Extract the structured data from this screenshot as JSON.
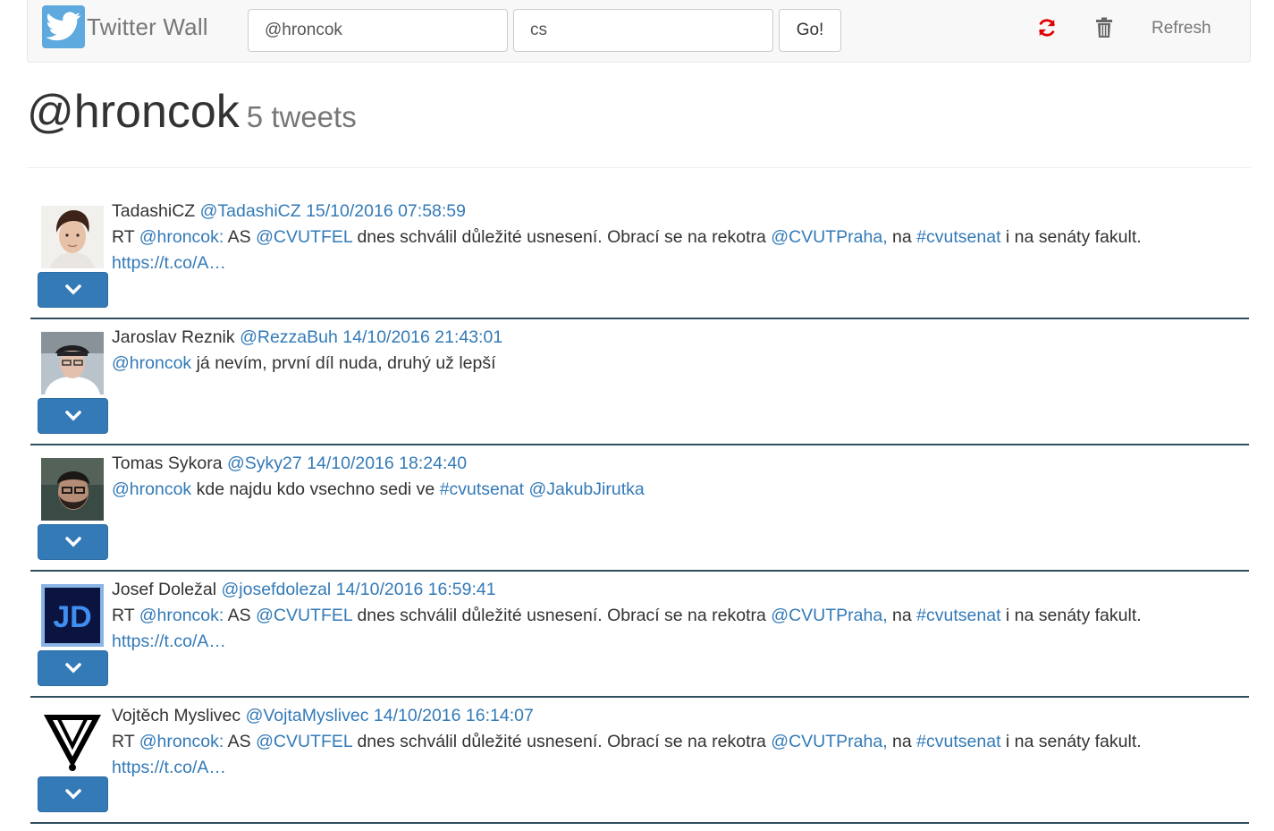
{
  "brand": {
    "title": "Twitter Wall",
    "logo_icon": "twitter-bird-icon"
  },
  "search": {
    "query_value": "@hroncok",
    "lang_value": "cs",
    "go_label": "Go!"
  },
  "toolbar": {
    "refresh_icon": "refresh-icon",
    "trash_icon": "trash-icon",
    "refresh_label": "Refresh"
  },
  "header": {
    "title": "@hroncok",
    "count": "5 tweets"
  },
  "colors": {
    "link": "#337ab7",
    "button": "#337ab7",
    "refresh_icon": "#e00000",
    "separator": "#2f4f5f"
  },
  "tweets": [
    {
      "author": "TadashiCZ",
      "handle": "@TadashiCZ",
      "time": "15/10/2016 07:58:59",
      "rt": "RT",
      "mention": "@hroncok:",
      "t1": "AS",
      "m2": "@CVUTFEL",
      "t2": "dnes schválil důležité usnesení. Obrací se na rekotra",
      "m3": "@CVUTPraha,",
      "t3": "na",
      "tag": "#cvutsenat",
      "t4": "i na senáty fakult.",
      "link": "https://t.co/A…"
    },
    {
      "author": "Jaroslav Reznik",
      "handle": "@RezzaBuh",
      "time": "14/10/2016 21:43:01",
      "mention": "@hroncok",
      "text": "já nevím, první díl nuda, druhý už lepší"
    },
    {
      "author": "Tomas Sykora",
      "handle": "@Syky27",
      "time": "14/10/2016 18:24:40",
      "mention": "@hroncok",
      "text": "kde najdu kdo vsechno sedi ve",
      "tag": "#cvutsenat",
      "mention2": "@JakubJirutka"
    },
    {
      "author": "Josef Doležal",
      "handle": "@josefdolezal",
      "time": "14/10/2016 16:59:41",
      "rt": "RT",
      "mention": "@hroncok:",
      "t1": "AS",
      "m2": "@CVUTFEL",
      "t2": "dnes schválil důležité usnesení. Obrací se na rekotra",
      "m3": "@CVUTPraha,",
      "t3": "na",
      "tag": "#cvutsenat",
      "t4": "i na senáty fakult.",
      "link": "https://t.co/A…",
      "avatar_text": "JD"
    },
    {
      "author": "Vojtěch Myslivec",
      "handle": "@VojtaMyslivec",
      "time": "14/10/2016 16:14:07",
      "rt": "RT",
      "mention": "@hroncok:",
      "t1": "AS",
      "m2": "@CVUTFEL",
      "t2": "dnes schválil důležité usnesení. Obrací se na rekotra",
      "m3": "@CVUTPraha,",
      "t3": "na",
      "tag": "#cvutsenat",
      "t4": "i na senáty fakult.",
      "link": "https://t.co/A…"
    }
  ]
}
